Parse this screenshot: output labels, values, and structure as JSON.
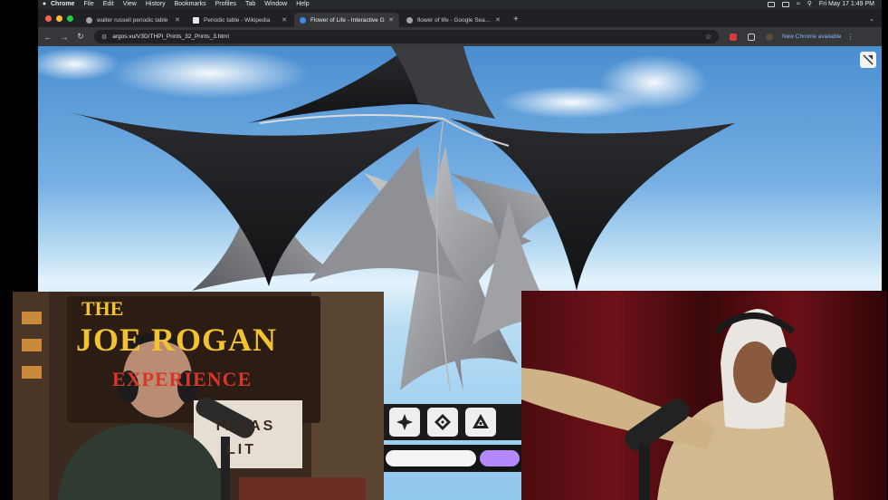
{
  "menubar": {
    "items": [
      "Chrome",
      "File",
      "Edit",
      "View",
      "History",
      "Bookmarks",
      "Profiles",
      "Tab",
      "Window",
      "Help"
    ],
    "clock": "Fri May 17  1:49 PM"
  },
  "tabs": [
    {
      "title": "walter russell periodic table",
      "favicon": "google-favicon",
      "active": false
    },
    {
      "title": "Periodic table - Wikipedia",
      "favicon": "wikipedia-favicon",
      "active": false
    },
    {
      "title": "Flower of Life - Interactive G",
      "favicon": "site-favicon",
      "active": true
    },
    {
      "title": "flower of life - Google Search",
      "favicon": "google-favicon",
      "active": false
    }
  ],
  "toolbar": {
    "url": "argos.vu/V3D/THPI_Prints_32_Prints_3.html",
    "update_label": "New Chrome available",
    "back_icon": "arrow-left-icon",
    "forward_icon": "arrow-right-icon",
    "reload_icon": "reload-icon"
  },
  "overlay": {
    "left_sign": {
      "line1": "THE",
      "line2": "JOE ROGAN",
      "line3": "EXPERIENCE",
      "sub1": "TEXAS",
      "sub2": "LIT"
    }
  },
  "colors": {
    "accent": "#8ab4f8",
    "slider_thumb": "#b489ff",
    "sign_yellow": "#f2c230",
    "sign_red": "#d9362a"
  }
}
